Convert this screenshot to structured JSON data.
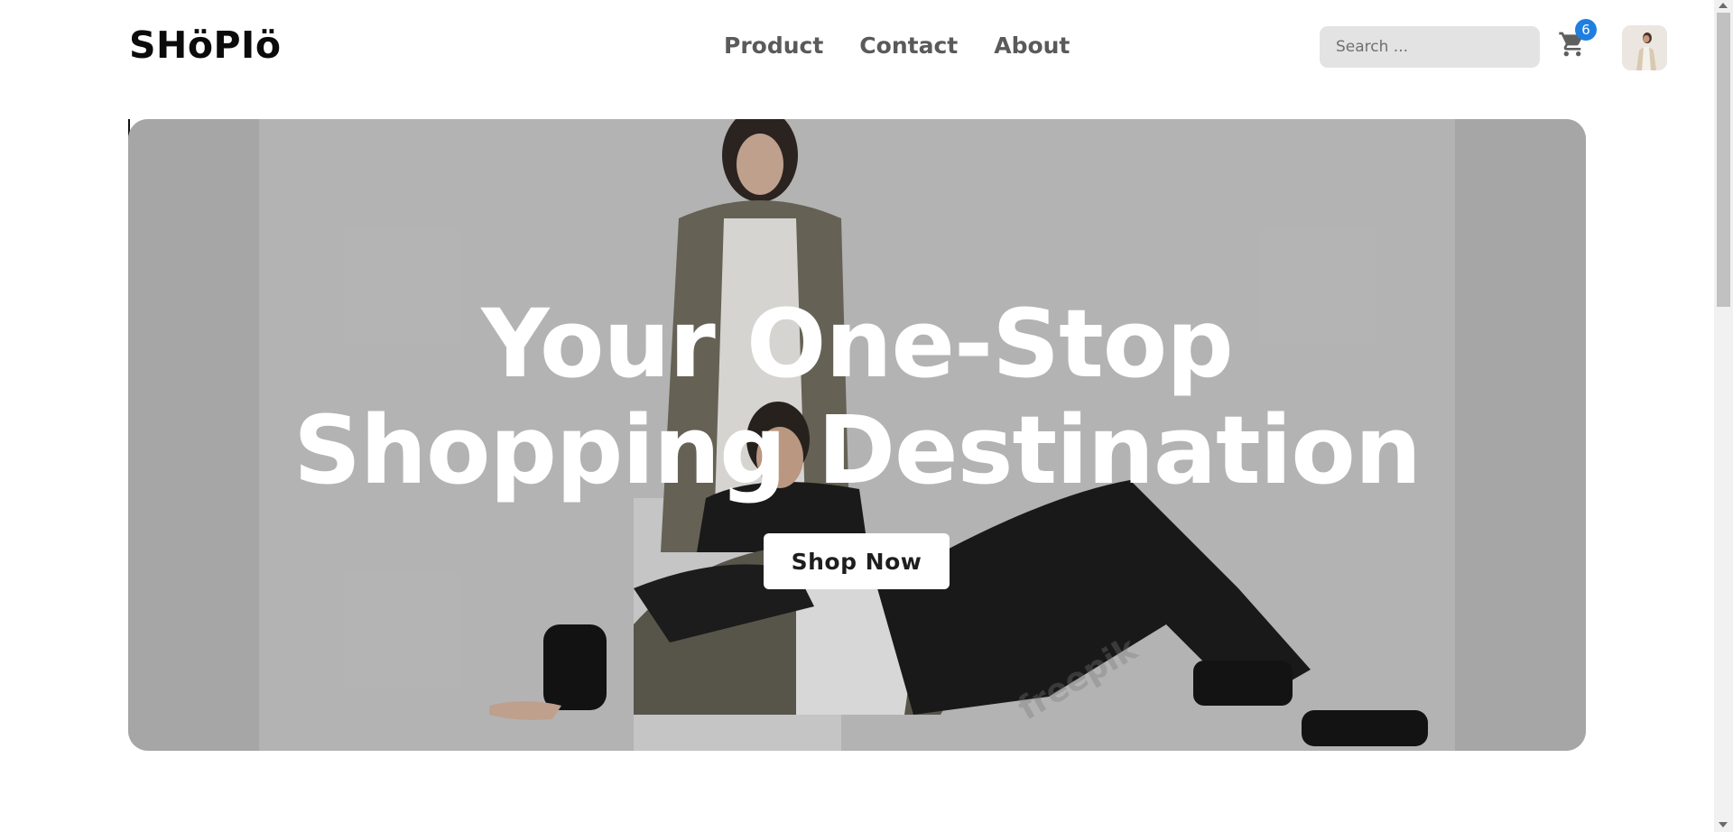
{
  "header": {
    "logo": "SHöPIö",
    "nav": [
      {
        "label": "Product"
      },
      {
        "label": "Contact"
      },
      {
        "label": "About"
      }
    ],
    "search": {
      "placeholder": "Search ...",
      "value": ""
    },
    "cart": {
      "icon": "cart-icon",
      "count": "6"
    },
    "avatar": {
      "icon": "user-avatar-photo"
    }
  },
  "hero": {
    "title_line1": "Your One-Stop",
    "title_line2": "Shopping Destination",
    "cta_label": "Shop Now",
    "watermark": "freepik"
  },
  "colors": {
    "badge": "#1f7fe0",
    "hero_background": "#b4b4b4",
    "search_background": "#e3e3e3",
    "nav_text": "#5a5a5a"
  }
}
